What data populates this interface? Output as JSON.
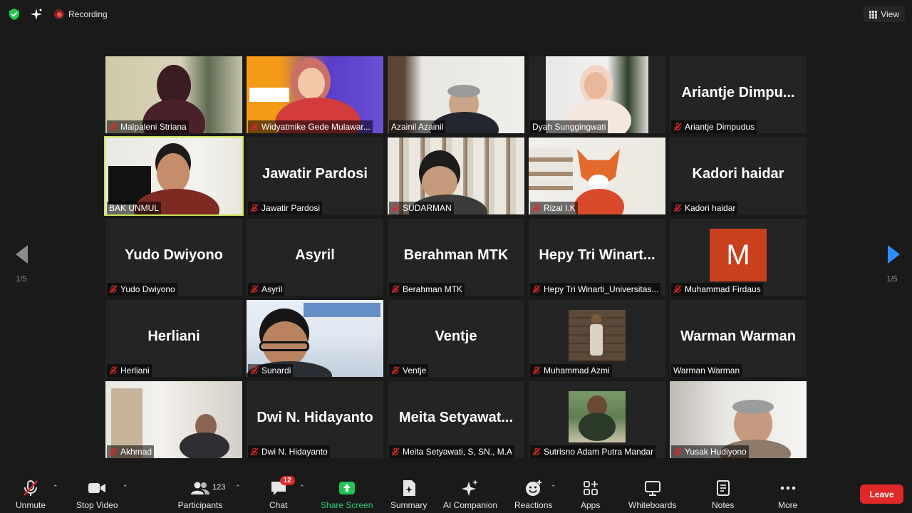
{
  "topbar": {
    "recording_label": "Recording",
    "view_label": "View"
  },
  "pager": {
    "left_page": "1/5",
    "right_page": "1/5"
  },
  "tiles": [
    {
      "name": "Malpaleni Striana",
      "video": true,
      "muted": true
    },
    {
      "name": "Widyatmike Gede Mulawar...",
      "video": true,
      "muted": true
    },
    {
      "name": "Azainil Azainil",
      "video": true,
      "muted": false
    },
    {
      "name": "Dyah Sunggingwati",
      "video": true,
      "muted": false
    },
    {
      "name": "Ariantje Dimpudus",
      "big": "Ariantje  Dimpu...",
      "video": false,
      "muted": true
    },
    {
      "name": "BAK UNMUL",
      "video": true,
      "muted": false,
      "active": true
    },
    {
      "name": "Jawatir Pardosi",
      "big": "Jawatir Pardosi",
      "video": false,
      "muted": true
    },
    {
      "name": "SUDARMAN",
      "video": true,
      "muted": true
    },
    {
      "name": "Rizal I.K",
      "video": true,
      "muted": true
    },
    {
      "name": "Kadori haidar",
      "big": "Kadori haidar",
      "video": false,
      "muted": true
    },
    {
      "name": "Yudo Dwiyono",
      "big": "Yudo Dwiyono",
      "video": false,
      "muted": true
    },
    {
      "name": "Asyril",
      "big": "Asyril",
      "video": false,
      "muted": true
    },
    {
      "name": "Berahman MTK",
      "big": "Berahman MTK",
      "video": false,
      "muted": true
    },
    {
      "name": "Hepy Tri Winarti_Universitas...",
      "big": "Hepy  Tri  Winart...",
      "video": false,
      "muted": true
    },
    {
      "name": "Muhammad Firdaus",
      "avatar": "M",
      "video": false,
      "muted": true
    },
    {
      "name": "Herliani",
      "big": "Herliani",
      "video": false,
      "muted": true
    },
    {
      "name": "Sunardi",
      "video": true,
      "muted": true
    },
    {
      "name": "Ventje",
      "big": "Ventje",
      "video": false,
      "muted": true
    },
    {
      "name": "Muhammad Azmi",
      "video": true,
      "muted": true
    },
    {
      "name": "Warman Warman",
      "big": "Warman Warman",
      "video": false,
      "muted": false
    },
    {
      "name": "Akhmad",
      "video": true,
      "muted": true
    },
    {
      "name": "Dwi N. Hidayanto",
      "big": "Dwi N. Hidayanto",
      "video": false,
      "muted": true
    },
    {
      "name": "Meita Setyawati, S, SN., M.A",
      "big": "Meita  Setyawat...",
      "video": false,
      "muted": true
    },
    {
      "name": "Sutrisno Adam Putra Mandar",
      "video": true,
      "muted": true
    },
    {
      "name": "Yusak Hudiyono",
      "video": true,
      "muted": true
    }
  ],
  "toolbar": {
    "unmute": "Unmute",
    "stop_video": "Stop Video",
    "participants": "Participants",
    "participants_count": "123",
    "chat": "Chat",
    "chat_badge": "12",
    "share_screen": "Share Screen",
    "summary": "Summary",
    "ai_companion": "AI Companion",
    "reactions": "Reactions",
    "apps": "Apps",
    "whiteboards": "Whiteboards",
    "notes": "Notes",
    "more": "More",
    "leave": "Leave"
  },
  "colors": {
    "background": "#1a1a1a",
    "tile": "#242424",
    "active_speaker": "#c7e255",
    "share_green": "#2ecc71",
    "leave_red": "#e02828",
    "pager_blue": "#2d8cff",
    "muted_red": "#e02828"
  }
}
